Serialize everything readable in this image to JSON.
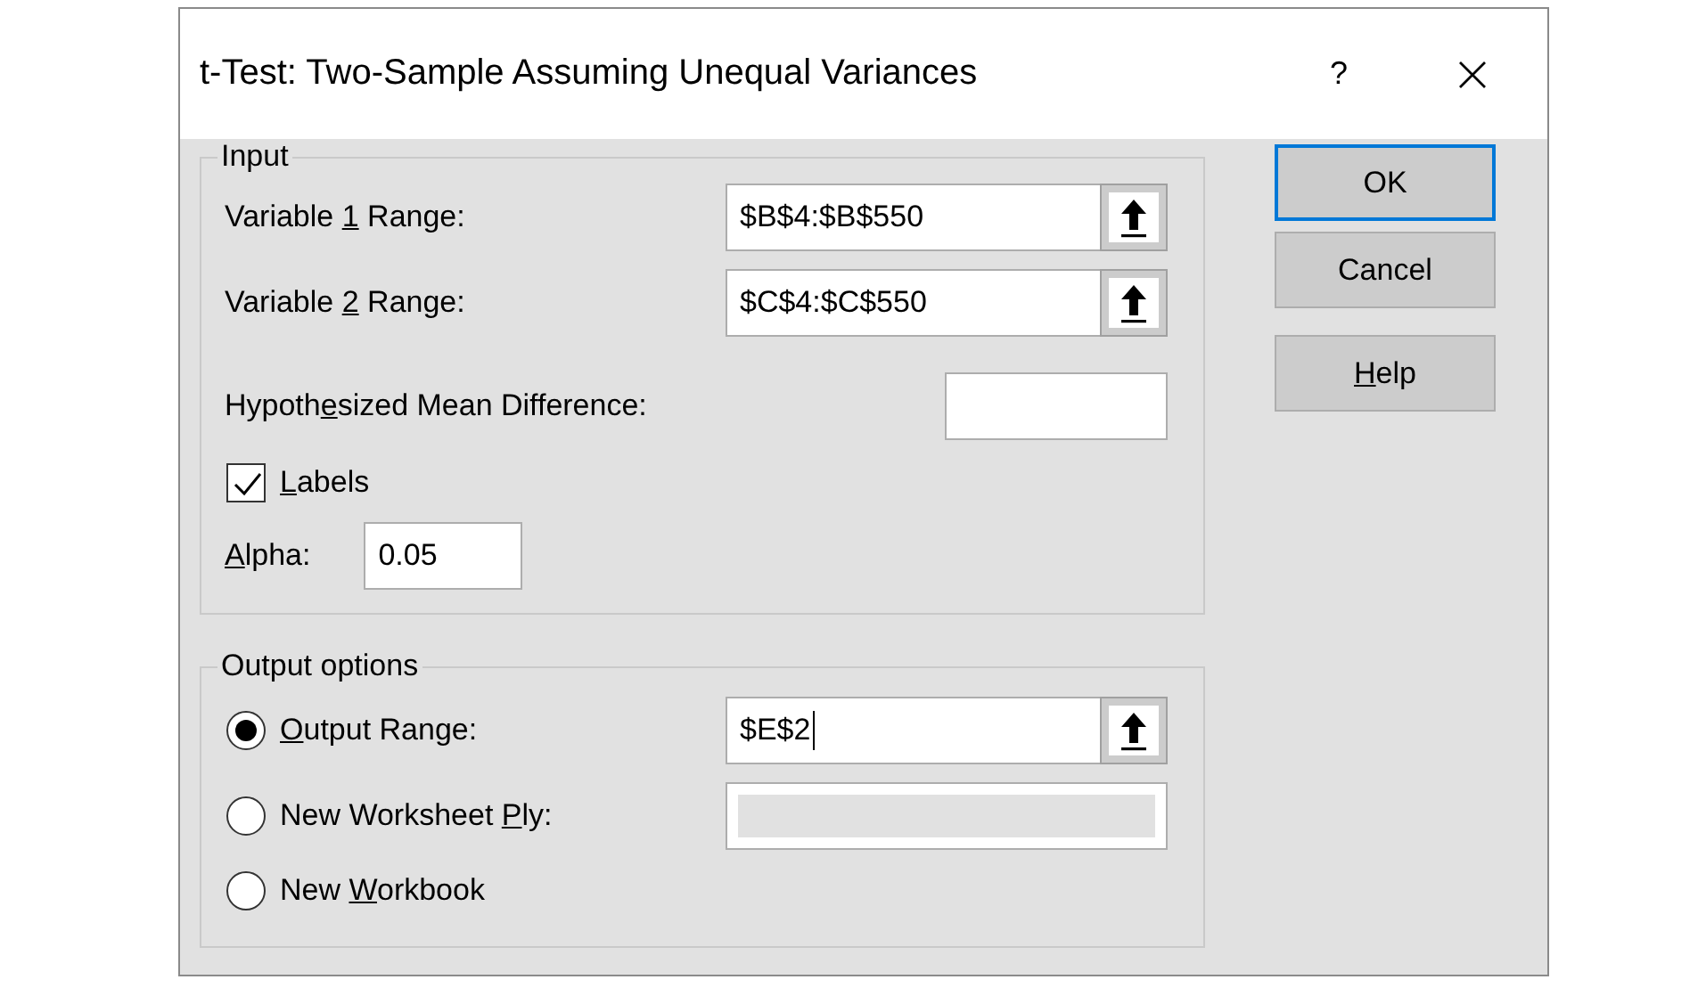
{
  "window": {
    "title": "t-Test: Two-Sample Assuming Unequal Variances",
    "help_button": "?"
  },
  "input_group": {
    "title": "Input",
    "fields": [
      {
        "kind": "range",
        "label": {
          "pre": "Variable ",
          "key": "1",
          "post": " Range:"
        },
        "value": "$B$4:$B$550"
      },
      {
        "kind": "range",
        "label": {
          "pre": "Variable ",
          "key": "2",
          "post": " Range:"
        },
        "value": "$C$4:$C$550"
      },
      {
        "kind": "number",
        "label": {
          "pre": "Hypoth",
          "key": "e",
          "post": "sized Mean Difference:"
        }
      },
      {
        "kind": "checkbox",
        "label": {
          "key": "L",
          "post": "abels"
        },
        "checked": true
      },
      {
        "kind": "short",
        "label": {
          "key": "A",
          "post": "lpha:"
        },
        "value": "0.05"
      }
    ]
  },
  "output_group": {
    "title": "Output options",
    "options": [
      {
        "label": {
          "key": "O",
          "post": "utput Range:"
        },
        "selected": true,
        "field": {
          "kind": "range",
          "value": "$E$2",
          "focused": true,
          "disabled": false
        }
      },
      {
        "label": {
          "pre": "New Worksheet ",
          "key": "P",
          "post": "ly:"
        },
        "selected": false,
        "field": {
          "kind": "plain",
          "focused": false,
          "disabled": true
        }
      },
      {
        "label": {
          "pre": "New ",
          "key": "W",
          "post": "orkbook"
        },
        "selected": false
      }
    ]
  },
  "buttons": [
    {
      "label": {
        "pre": "OK"
      },
      "default": true
    },
    {
      "label": {
        "pre": "Cancel"
      },
      "default": false
    },
    {
      "label": {
        "key": "H",
        "post": "elp"
      },
      "default": false
    }
  ]
}
